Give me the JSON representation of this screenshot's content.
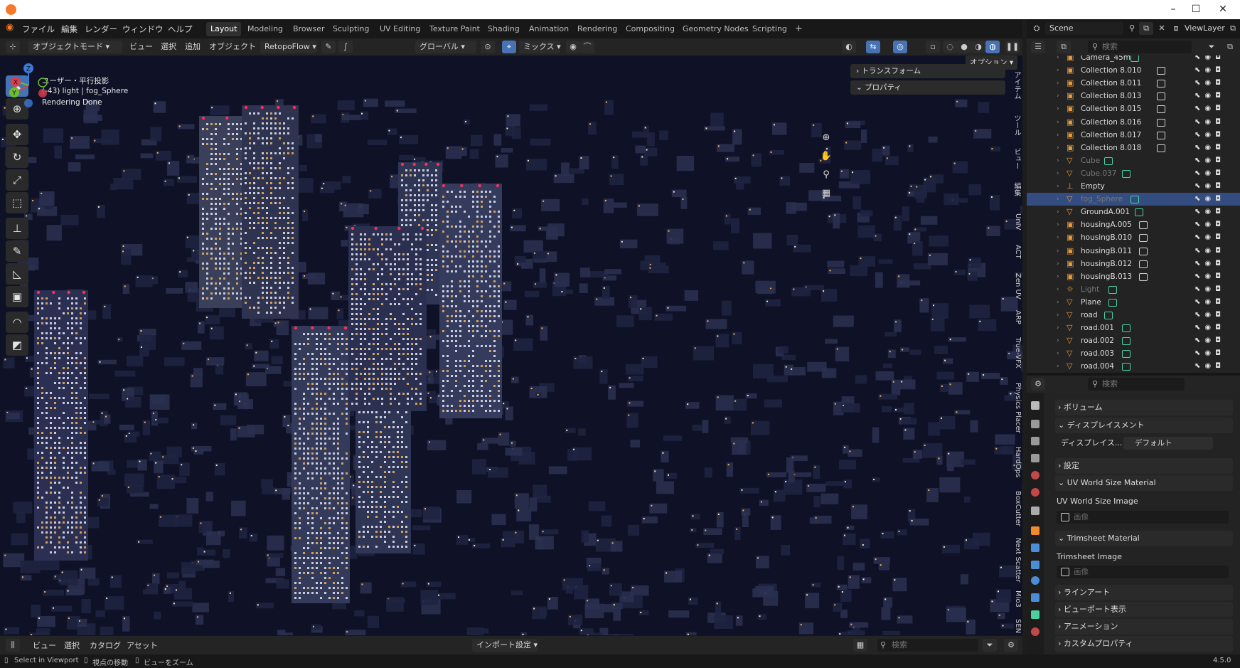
{
  "titlebar": {
    "minimize": "–",
    "maximize": "☐",
    "close": "✕"
  },
  "menu": {
    "file": "ファイル",
    "edit": "編集",
    "render": "レンダー",
    "window": "ウィンドウ",
    "help": "ヘルプ"
  },
  "workspaces": [
    "Layout",
    "Modeling",
    "Browser",
    "Sculpting",
    "UV Editing",
    "Texture Paint",
    "Shading",
    "Animation",
    "Rendering",
    "Compositing",
    "Geometry Nodes",
    "Scripting"
  ],
  "workspace_add": "+",
  "active_workspace": "Layout",
  "viewport_header": {
    "mode": "オブジェクトモード",
    "view": "ビュー",
    "select": "選択",
    "add": "追加",
    "object": "オブジェクト",
    "addon": "RetopoFlow",
    "orientation": "グローバル",
    "snap": "ミックス"
  },
  "viewport": {
    "view_name": "ユーザー・平行投影",
    "object_info": "(-43) light | fog_Sphere",
    "render_status": "Rendering Done",
    "options_label": "オプション",
    "gizmo_axes": {
      "z": "Z",
      "x": "X",
      "y": "Y"
    },
    "panels": [
      "トランスフォーム",
      "プロパティ"
    ],
    "sidebar_tabs": [
      "アイテム",
      "ツール",
      "ビュー",
      "編集",
      "UnIV",
      "ACT",
      "Zen UV",
      "ARP",
      "True-VFX",
      "Physics Placer",
      "HardOps",
      "BoxCutter",
      "Next Scatter",
      "Mio3",
      "SEN"
    ]
  },
  "tools": [
    "select",
    "cursor",
    "move",
    "rotate",
    "scale",
    "transform",
    "annotate",
    "measure",
    "add-cube",
    "shear",
    "transform-box"
  ],
  "asset_bar": {
    "view": "ビュー",
    "select": "選択",
    "catalog": "カタログ",
    "asset": "アセット",
    "import_settings": "インポート設定",
    "search_placeholder": "検索"
  },
  "statusbar": {
    "select": "Select in Viewport",
    "move_view": "視点の移動",
    "zoom_view": "ビューをズーム",
    "version": "4.5.0"
  },
  "outliner": {
    "scene": "Scene",
    "view_layer": "ViewLayer",
    "search_placeholder": "検索",
    "items": [
      {
        "name": "Camera_45m",
        "type": "collection",
        "ext": "camera",
        "dim": false,
        "selected": false
      },
      {
        "name": "Collection 8.010",
        "type": "collection",
        "ext": "collection",
        "dim": false,
        "selected": false
      },
      {
        "name": "Collection 8.011",
        "type": "collection",
        "ext": "collection",
        "dim": false,
        "selected": false
      },
      {
        "name": "Collection 8.013",
        "type": "collection",
        "ext": "collection",
        "dim": false,
        "selected": false
      },
      {
        "name": "Collection 8.015",
        "type": "collection",
        "ext": "collection",
        "dim": false,
        "selected": false
      },
      {
        "name": "Collection 8.016",
        "type": "collection",
        "ext": "collection",
        "dim": false,
        "selected": false
      },
      {
        "name": "Collection 8.017",
        "type": "collection",
        "ext": "collection",
        "dim": false,
        "selected": false
      },
      {
        "name": "Collection 8.018",
        "type": "collection",
        "ext": "collection",
        "dim": false,
        "selected": false
      },
      {
        "name": "Cube",
        "type": "mesh",
        "ext": "mesh",
        "dim": true,
        "selected": false
      },
      {
        "name": "Cube.037",
        "type": "mesh",
        "ext": "mesh",
        "dim": true,
        "selected": false
      },
      {
        "name": "Empty",
        "type": "empty",
        "ext": "",
        "dim": false,
        "selected": false
      },
      {
        "name": "fog_Sphere",
        "type": "mesh",
        "ext": "mesh",
        "dim": true,
        "selected": true
      },
      {
        "name": "GroundA.001",
        "type": "mesh",
        "ext": "mesh",
        "dim": false,
        "selected": false
      },
      {
        "name": "housingA.005",
        "type": "collection",
        "ext": "collection",
        "dim": false,
        "selected": false
      },
      {
        "name": "housingB.010",
        "type": "collection",
        "ext": "collection",
        "dim": false,
        "selected": false
      },
      {
        "name": "housingB.011",
        "type": "collection",
        "ext": "collection",
        "dim": false,
        "selected": false
      },
      {
        "name": "housingB.012",
        "type": "collection",
        "ext": "collection",
        "dim": false,
        "selected": false
      },
      {
        "name": "housingB.013",
        "type": "collection",
        "ext": "collection",
        "dim": false,
        "selected": false
      },
      {
        "name": "Light",
        "type": "light",
        "ext": "light",
        "dim": true,
        "selected": false
      },
      {
        "name": "Plane",
        "type": "mesh",
        "ext": "mesh",
        "dim": false,
        "selected": false
      },
      {
        "name": "road",
        "type": "mesh",
        "ext": "mesh",
        "dim": false,
        "selected": false
      },
      {
        "name": "road.001",
        "type": "mesh",
        "ext": "mesh",
        "dim": false,
        "selected": false
      },
      {
        "name": "road.002",
        "type": "mesh",
        "ext": "mesh",
        "dim": false,
        "selected": false
      },
      {
        "name": "road.003",
        "type": "mesh",
        "ext": "mesh",
        "dim": false,
        "selected": false
      },
      {
        "name": "road.004",
        "type": "mesh",
        "ext": "mesh",
        "dim": false,
        "selected": false
      }
    ]
  },
  "properties": {
    "search_placeholder": "検索",
    "volume": "ボリューム",
    "displacement": "ディスプレイスメント",
    "displacement_label": "ディスプレイス...",
    "displacement_value": "デフォルト",
    "settings": "設定",
    "uv_world_size_material": "UV World Size Material",
    "uv_world_size_image": "UV World Size Image",
    "image_placeholder": "画像",
    "trimsheet_material": "Trimsheet Material",
    "trimsheet_image": "Trimsheet Image",
    "line_art": "ラインアート",
    "viewport_display": "ビューポート表示",
    "animation": "アニメーション",
    "custom_properties": "カスタムプロパティ"
  },
  "colors": {
    "accent": "#4772b3",
    "selected_row": "#334d80",
    "collection_icon": "#f0a04b",
    "mesh_icon": "#f0a04b",
    "mesh_data": "#4bd1a0"
  }
}
